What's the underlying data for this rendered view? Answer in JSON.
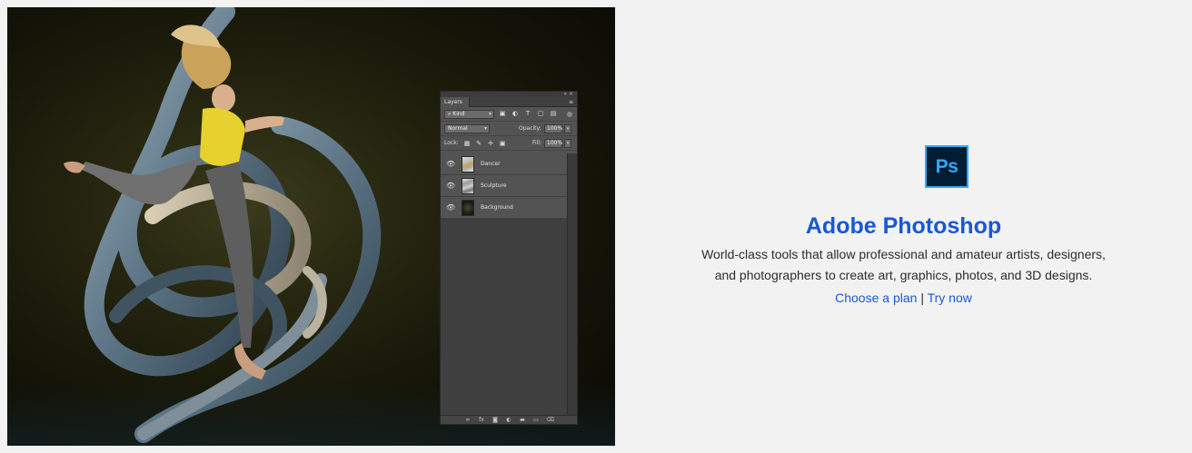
{
  "hero": {
    "panel": {
      "tab_label": "Layers",
      "menu_glyph": "≡",
      "kind_select": "Kind",
      "blend_mode": "Normal",
      "opacity_label": "Opacity:",
      "opacity_value": "100%",
      "lock_label": "Lock:",
      "fill_label": "Fill:",
      "fill_value": "100%",
      "layers": [
        {
          "name": "Dancer"
        },
        {
          "name": "Sculpture"
        },
        {
          "name": "Background"
        }
      ]
    }
  },
  "product": {
    "logo_text": "Ps",
    "title": "Adobe Photoshop",
    "description_line1": "World-class tools that allow professional and amateur artists, designers,",
    "description_line2": "and photographers to create art, graphics, photos, and 3D designs.",
    "link_plan": "Choose a plan",
    "separator": "|",
    "link_try": "Try now"
  },
  "colors": {
    "brand_blue": "#1a57d6",
    "ps_logo_bg": "#001d34",
    "ps_logo_fg": "#31a8ff",
    "page_bg": "#f2f2f2"
  }
}
